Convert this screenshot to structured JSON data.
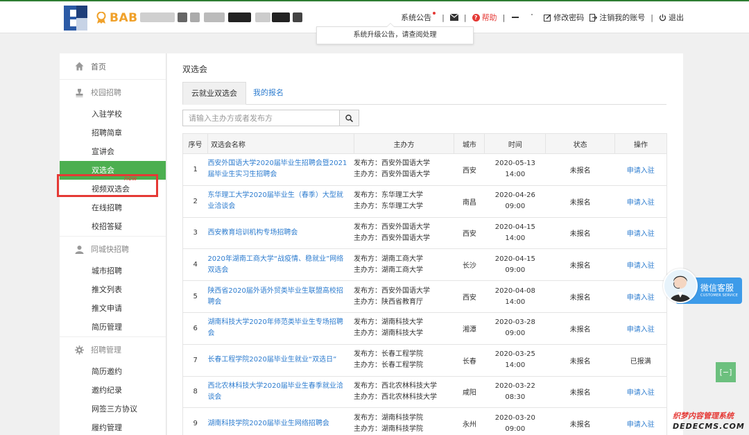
{
  "header": {
    "brand_text": "BAB",
    "notice_label": "系统公告",
    "help_label": "帮助",
    "change_password_label": "修改密码",
    "cancel_account_label": "注销我的账号",
    "logout_label": "退出",
    "notice_tooltip": "系统升级公告，请查阅处理"
  },
  "sidebar": {
    "home": "首页",
    "groups": [
      {
        "title": "校园招聘",
        "items": [
          "入驻学校",
          "招聘简章",
          "宣讲会",
          "双选会",
          "视频双选会",
          "在线招聘",
          "校招答疑"
        ]
      },
      {
        "title": "同城快招聘",
        "items": [
          "城市招聘",
          "推文列表",
          "推文申请",
          "简历管理"
        ]
      },
      {
        "title": "招聘管理",
        "items": [
          "简历邀约",
          "邀约纪录",
          "网签三方协议",
          "履约管理"
        ]
      }
    ],
    "new_tag": "new"
  },
  "main": {
    "page_title": "双选会",
    "tabs": [
      {
        "label": "云就业双选会"
      },
      {
        "label": "我的报名"
      }
    ],
    "search_placeholder": "请输入主办方或者发布方",
    "columns": [
      "序号",
      "双选会名称",
      "主办方",
      "城市",
      "时间",
      "状态",
      "操作"
    ],
    "publisher_prefix": "发布方：",
    "organizer_prefix": "主办方：",
    "rows": [
      {
        "no": "1",
        "name": "西安外国语大学2020届毕业生招聘会暨2021届毕业生实习生招聘会",
        "publisher": "西安外国语大学",
        "organizer": "西安外国语大学",
        "city": "西安",
        "date": "2020-05-13",
        "time": "14:00",
        "status": "未报名",
        "action": "申请入驻"
      },
      {
        "no": "2",
        "name": "东华理工大学2020届毕业生（春季）大型就业洽谈会",
        "publisher": "东华理工大学",
        "organizer": "东华理工大学",
        "city": "南昌",
        "date": "2020-04-26",
        "time": "09:00",
        "status": "未报名",
        "action": "申请入驻"
      },
      {
        "no": "3",
        "name": "西安教育培训机构专场招聘会",
        "publisher": "西安外国语大学",
        "organizer": "西安外国语大学",
        "city": "西安",
        "date": "2020-04-15",
        "time": "14:00",
        "status": "未报名",
        "action": "申请入驻"
      },
      {
        "no": "4",
        "name": "2020年湖南工商大学“战疫情、稳就业”网络双选会",
        "publisher": "湖南工商大学",
        "organizer": "湖南工商大学",
        "city": "长沙",
        "date": "2020-04-15",
        "time": "09:00",
        "status": "未报名",
        "action": "申请入驻"
      },
      {
        "no": "5",
        "name": "陕西省2020届外语外贸类毕业生联盟高校招聘会",
        "publisher": "西安外国语大学",
        "organizer": "陕西省教育厅",
        "city": "西安",
        "date": "2020-04-08",
        "time": "14:00",
        "status": "未报名",
        "action": "申请入驻"
      },
      {
        "no": "6",
        "name": "湖南科技大学2020年师范类毕业生专场招聘会",
        "publisher": "湖南科技大学",
        "organizer": "湖南科技大学",
        "city": "湘潭",
        "date": "2020-03-28",
        "time": "09:00",
        "status": "未报名",
        "action": "申请入驻"
      },
      {
        "no": "7",
        "name": "长春工程学院2020届毕业生就业“双选日”",
        "publisher": "长春工程学院",
        "organizer": "长春工程学院",
        "city": "长春",
        "date": "2020-03-25",
        "time": "14:00",
        "status": "未报名",
        "action": "已报满"
      },
      {
        "no": "8",
        "name": "西北农林科技大学2020届毕业生春季就业洽谈会",
        "publisher": "西北农林科技大学",
        "organizer": "西北农林科技大学",
        "city": "咸阳",
        "date": "2020-03-22",
        "time": "08:30",
        "status": "未报名",
        "action": "申请入驻"
      },
      {
        "no": "9",
        "name": "湖南科技学院2020届毕业生网络招聘会",
        "publisher": "湖南科技学院",
        "organizer": "湖南科技学院",
        "city": "永州",
        "date": "2020-03-20",
        "time": "09:00",
        "status": "未报名",
        "action": "申请入驻"
      }
    ]
  },
  "customer_service": {
    "title": "微信客服",
    "subtitle": "CUSTOMER SERVICE"
  },
  "float_button": "[−]",
  "watermark": {
    "top": "织梦内容管理系统",
    "bottom": "DEDECMS.COM"
  },
  "colors": {
    "accent_green": "#4caf50",
    "link_blue": "#2d7ccf",
    "brand_orange": "#f0a12a",
    "highlight_red": "#e53935"
  }
}
